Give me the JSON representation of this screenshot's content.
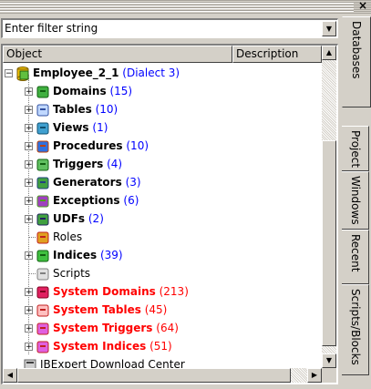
{
  "window": {
    "close_glyph": "×"
  },
  "filter": {
    "value": "Enter filter string"
  },
  "columns": {
    "object": "Object",
    "description": "Description"
  },
  "tree": {
    "root": {
      "label": "Employee_2_1",
      "detail": "(Dialect 3)"
    },
    "items": [
      {
        "label": "Domains",
        "count": "(15)",
        "icon": "domain-icon",
        "expand": true,
        "system": false
      },
      {
        "label": "Tables",
        "count": "(10)",
        "icon": "table-icon",
        "expand": true,
        "system": false
      },
      {
        "label": "Views",
        "count": "(1)",
        "icon": "view-icon",
        "expand": true,
        "system": false
      },
      {
        "label": "Procedures",
        "count": "(10)",
        "icon": "procedure-icon",
        "expand": true,
        "system": false
      },
      {
        "label": "Triggers",
        "count": "(4)",
        "icon": "trigger-icon",
        "expand": true,
        "system": false
      },
      {
        "label": "Generators",
        "count": "(3)",
        "icon": "generator-icon",
        "expand": true,
        "system": false
      },
      {
        "label": "Exceptions",
        "count": "(6)",
        "icon": "exception-icon",
        "expand": true,
        "system": false
      },
      {
        "label": "UDFs",
        "count": "(2)",
        "icon": "udf-icon",
        "expand": true,
        "system": false
      },
      {
        "label": "Roles",
        "count": "",
        "icon": "role-icon",
        "expand": false,
        "system": false,
        "plain": true
      },
      {
        "label": "Indices",
        "count": "(39)",
        "icon": "index-icon",
        "expand": true,
        "system": false
      },
      {
        "label": "Scripts",
        "count": "",
        "icon": "script-icon",
        "expand": false,
        "system": false,
        "plain": true
      },
      {
        "label": "System Domains",
        "count": "(213)",
        "icon": "system-domain-icon",
        "expand": true,
        "system": true
      },
      {
        "label": "System Tables",
        "count": "(45)",
        "icon": "system-table-icon",
        "expand": true,
        "system": true
      },
      {
        "label": "System Triggers",
        "count": "(64)",
        "icon": "system-trigger-icon",
        "expand": true,
        "system": true
      },
      {
        "label": "System Indices",
        "count": "(51)",
        "icon": "system-index-icon",
        "expand": true,
        "system": true
      }
    ],
    "bottom": {
      "label": "IBExpert Download Center"
    }
  },
  "tabs": [
    "Databases",
    "Project",
    "Windows",
    "Recent",
    "Scripts/Blocks"
  ],
  "colors": {
    "count_blue": "#0000ff",
    "system_red": "#ff0000"
  }
}
